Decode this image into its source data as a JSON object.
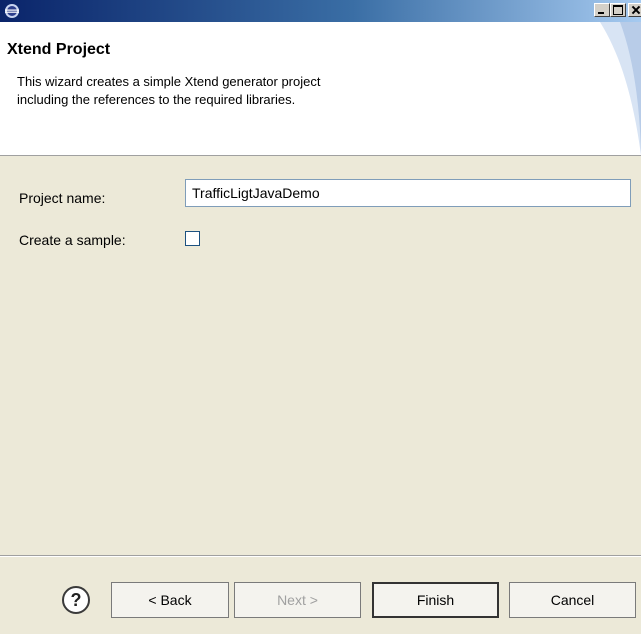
{
  "window": {
    "title": "",
    "controls": {
      "minimize": "minimize",
      "maximize": "maximize",
      "close": "close"
    }
  },
  "banner": {
    "title": "Xtend Project",
    "description_line1": "This wizard creates a simple Xtend generator project",
    "description_line2": "including the references to the required libraries."
  },
  "form": {
    "project_name_label": "Project name:",
    "project_name_value": "TrafficLigtJavaDemo",
    "create_sample_label": "Create a sample:",
    "create_sample_checked": false
  },
  "buttons": {
    "help": "?",
    "back": "< Back",
    "next": "Next >",
    "finish": "Finish",
    "cancel": "Cancel"
  },
  "icons": {
    "app": "eclipse-icon",
    "help": "help-icon"
  },
  "colors": {
    "titlebar_start": "#0a246a",
    "titlebar_end": "#a6caf0",
    "dialog_bg": "#ece9d8",
    "input_border": "#7f9db9"
  }
}
